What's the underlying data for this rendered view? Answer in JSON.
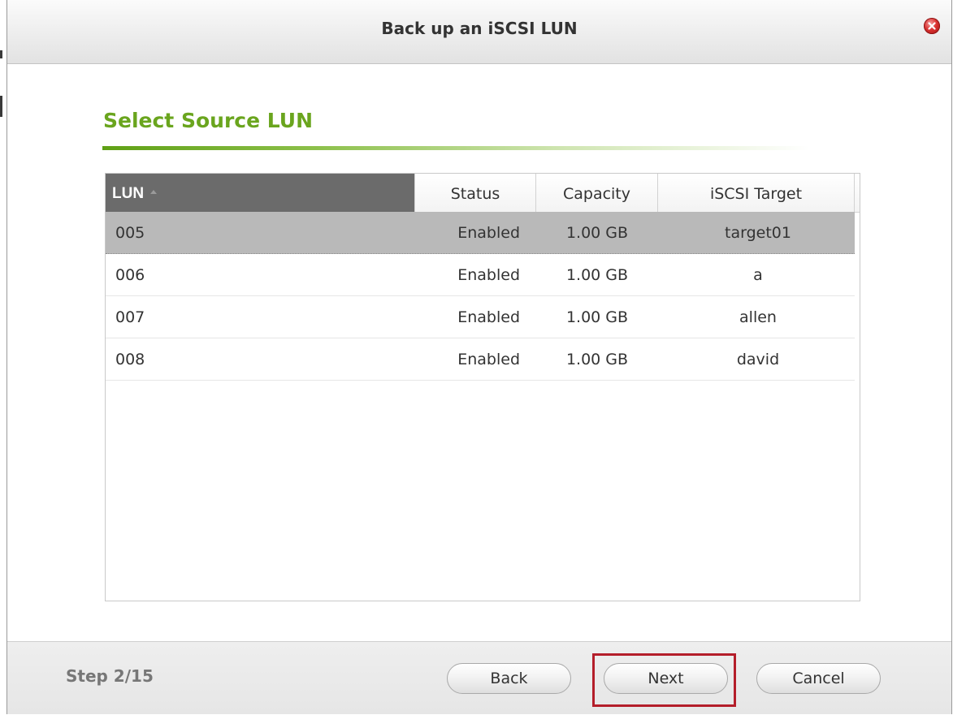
{
  "dialog": {
    "title": "Back up an iSCSI LUN"
  },
  "section": {
    "title": "Select Source LUN"
  },
  "grid": {
    "columns": [
      "LUN",
      "Status",
      "Capacity",
      "iSCSI Target"
    ],
    "sorted_column": "LUN",
    "sort_direction": "ascending",
    "rows": [
      {
        "lun": "005",
        "status": "Enabled",
        "capacity": "1.00 GB",
        "target": "target01",
        "selected": true
      },
      {
        "lun": "006",
        "status": "Enabled",
        "capacity": "1.00 GB",
        "target": "a",
        "selected": false
      },
      {
        "lun": "007",
        "status": "Enabled",
        "capacity": "1.00 GB",
        "target": "allen",
        "selected": false
      },
      {
        "lun": "008",
        "status": "Enabled",
        "capacity": "1.00 GB",
        "target": "david",
        "selected": false
      }
    ]
  },
  "footer": {
    "step": "Step 2/15",
    "back_label": "Back",
    "next_label": "Next",
    "cancel_label": "Cancel"
  },
  "colors": {
    "accent": "#6aa51e",
    "highlight": "#b41e2a",
    "selected_row": "#b9b9b9",
    "sorted_header": "#6b6b6b"
  },
  "icons": {
    "close": "close-icon",
    "sort": "sort-ascending-icon"
  }
}
